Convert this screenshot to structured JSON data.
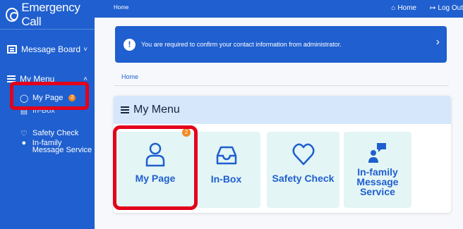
{
  "brand": {
    "title": "Emergency Call"
  },
  "topbar": {
    "crumb": "Home",
    "home": "Home",
    "logout": "Log Out"
  },
  "sidebar": {
    "message_board": "Message Board",
    "my_menu": "My Menu",
    "items": [
      {
        "label": "My Page",
        "badge": "2"
      },
      {
        "label": "In-Box"
      },
      {
        "label": "Safety Check"
      },
      {
        "label": "In-family Message Service"
      }
    ]
  },
  "notice": {
    "text": "You are required to confirm your contact information from administrator."
  },
  "breadcrumb": "Home",
  "menu": {
    "title": "My Menu",
    "tiles": [
      {
        "label": "My Page",
        "badge": "2"
      },
      {
        "label": "In-Box"
      },
      {
        "label": "Safety Check"
      },
      {
        "label": "In-family Message Service"
      }
    ]
  },
  "colors": {
    "primary": "#1f5fcf",
    "tile_bg": "#e3f5f5",
    "header_bg": "#d6e7fb",
    "badge": "#f08a24",
    "highlight": "#e3001b"
  }
}
